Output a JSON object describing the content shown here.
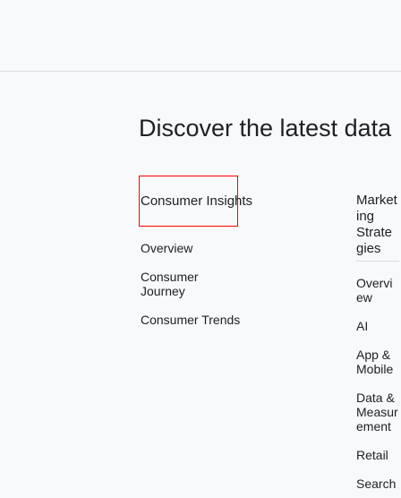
{
  "title": "Discover the latest data",
  "columns": [
    {
      "heading": "Consumer Insights",
      "items": [
        "Overview",
        "Consumer Journey",
        "Consumer Trends"
      ]
    },
    {
      "heading": "Marketing Strategies",
      "items": [
        "Overview",
        "AI",
        "App & Mobile",
        "Data & Measurement",
        "Retail",
        "Search"
      ]
    }
  ],
  "colors": {
    "background": "#f8f9fa",
    "text": "#202124",
    "highlight_box": "#ff0000",
    "divider": "#dadce0"
  }
}
